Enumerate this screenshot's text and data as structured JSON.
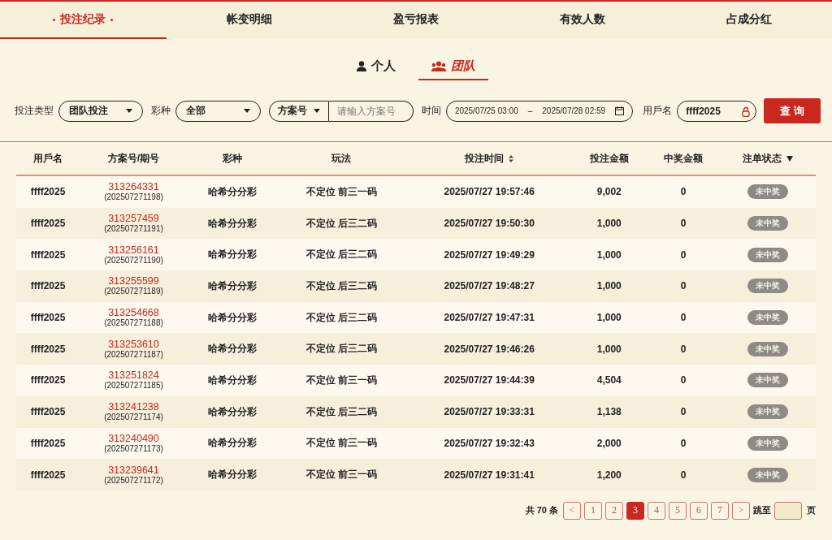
{
  "tabs": [
    {
      "label": "投注纪录",
      "selected": true
    },
    {
      "label": "帐变明细",
      "selected": false
    },
    {
      "label": "盈亏报表",
      "selected": false
    },
    {
      "label": "有效人数",
      "selected": false
    },
    {
      "label": "占成分红",
      "selected": false
    }
  ],
  "scope_tabs": [
    {
      "label": "个人",
      "selected": false
    },
    {
      "label": "团队",
      "selected": true
    }
  ],
  "filters": {
    "bet_type_label": "投注类型",
    "bet_type": "团队投注",
    "lottery_label": "彩种",
    "lottery": "全部",
    "plan_select": "方案号",
    "plan_placeholder": "请输入方案号",
    "time_label": "时间",
    "time_start": "2025/07/25 03:00",
    "time_sep": "–",
    "time_end": "2025/07/28 02:59",
    "user_label": "用戶名",
    "user_value": "ffff2025",
    "query_button": "查 询"
  },
  "table": {
    "columns": [
      "用戶名",
      "方案号/期号",
      "彩种",
      "玩法",
      "投注时间",
      "投注金额",
      "中奖金额",
      "注单状态"
    ],
    "rows": [
      {
        "user": "ffff2025",
        "plan": "313264331",
        "issue": "(202507271198)",
        "lottery": "哈希分分彩",
        "play": "不定位 前三一码",
        "time": "2025/07/27 19:57:46",
        "bet": "9,002",
        "win": "0",
        "status": "未中奖"
      },
      {
        "user": "ffff2025",
        "plan": "313257459",
        "issue": "(202507271191)",
        "lottery": "哈希分分彩",
        "play": "不定位 后三二码",
        "time": "2025/07/27 19:50:30",
        "bet": "1,000",
        "win": "0",
        "status": "未中奖"
      },
      {
        "user": "ffff2025",
        "plan": "313256161",
        "issue": "(202507271190)",
        "lottery": "哈希分分彩",
        "play": "不定位 后三二码",
        "time": "2025/07/27 19:49:29",
        "bet": "1,000",
        "win": "0",
        "status": "未中奖"
      },
      {
        "user": "ffff2025",
        "plan": "313255599",
        "issue": "(202507271189)",
        "lottery": "哈希分分彩",
        "play": "不定位 后三二码",
        "time": "2025/07/27 19:48:27",
        "bet": "1,000",
        "win": "0",
        "status": "未中奖"
      },
      {
        "user": "ffff2025",
        "plan": "313254668",
        "issue": "(202507271188)",
        "lottery": "哈希分分彩",
        "play": "不定位 后三二码",
        "time": "2025/07/27 19:47:31",
        "bet": "1,000",
        "win": "0",
        "status": "未中奖"
      },
      {
        "user": "ffff2025",
        "plan": "313253610",
        "issue": "(202507271187)",
        "lottery": "哈希分分彩",
        "play": "不定位 后三二码",
        "time": "2025/07/27 19:46:26",
        "bet": "1,000",
        "win": "0",
        "status": "未中奖"
      },
      {
        "user": "ffff2025",
        "plan": "313251824",
        "issue": "(202507271185)",
        "lottery": "哈希分分彩",
        "play": "不定位 前三一码",
        "time": "2025/07/27 19:44:39",
        "bet": "4,504",
        "win": "0",
        "status": "未中奖"
      },
      {
        "user": "ffff2025",
        "plan": "313241238",
        "issue": "(202507271174)",
        "lottery": "哈希分分彩",
        "play": "不定位 后三二码",
        "time": "2025/07/27 19:33:31",
        "bet": "1,138",
        "win": "0",
        "status": "未中奖"
      },
      {
        "user": "ffff2025",
        "plan": "313240490",
        "issue": "(202507271173)",
        "lottery": "哈希分分彩",
        "play": "不定位 前三一码",
        "time": "2025/07/27 19:32:43",
        "bet": "2,000",
        "win": "0",
        "status": "未中奖"
      },
      {
        "user": "ffff2025",
        "plan": "313239641",
        "issue": "(202507271172)",
        "lottery": "哈希分分彩",
        "play": "不定位 前三一码",
        "time": "2025/07/27 19:31:41",
        "bet": "1,200",
        "win": "0",
        "status": "未中奖"
      }
    ]
  },
  "pagination": {
    "total": "共 70 条",
    "pages": [
      {
        "label": "<",
        "selected": false
      },
      {
        "label": "1",
        "selected": false
      },
      {
        "label": "2",
        "selected": false
      },
      {
        "label": "3",
        "selected": true
      },
      {
        "label": "4",
        "selected": false
      },
      {
        "label": "5",
        "selected": false
      },
      {
        "label": "6",
        "selected": false
      },
      {
        "label": "7",
        "selected": false
      },
      {
        "label": ">",
        "selected": false
      }
    ],
    "jump_label": "跳至",
    "page_suffix": "页"
  }
}
